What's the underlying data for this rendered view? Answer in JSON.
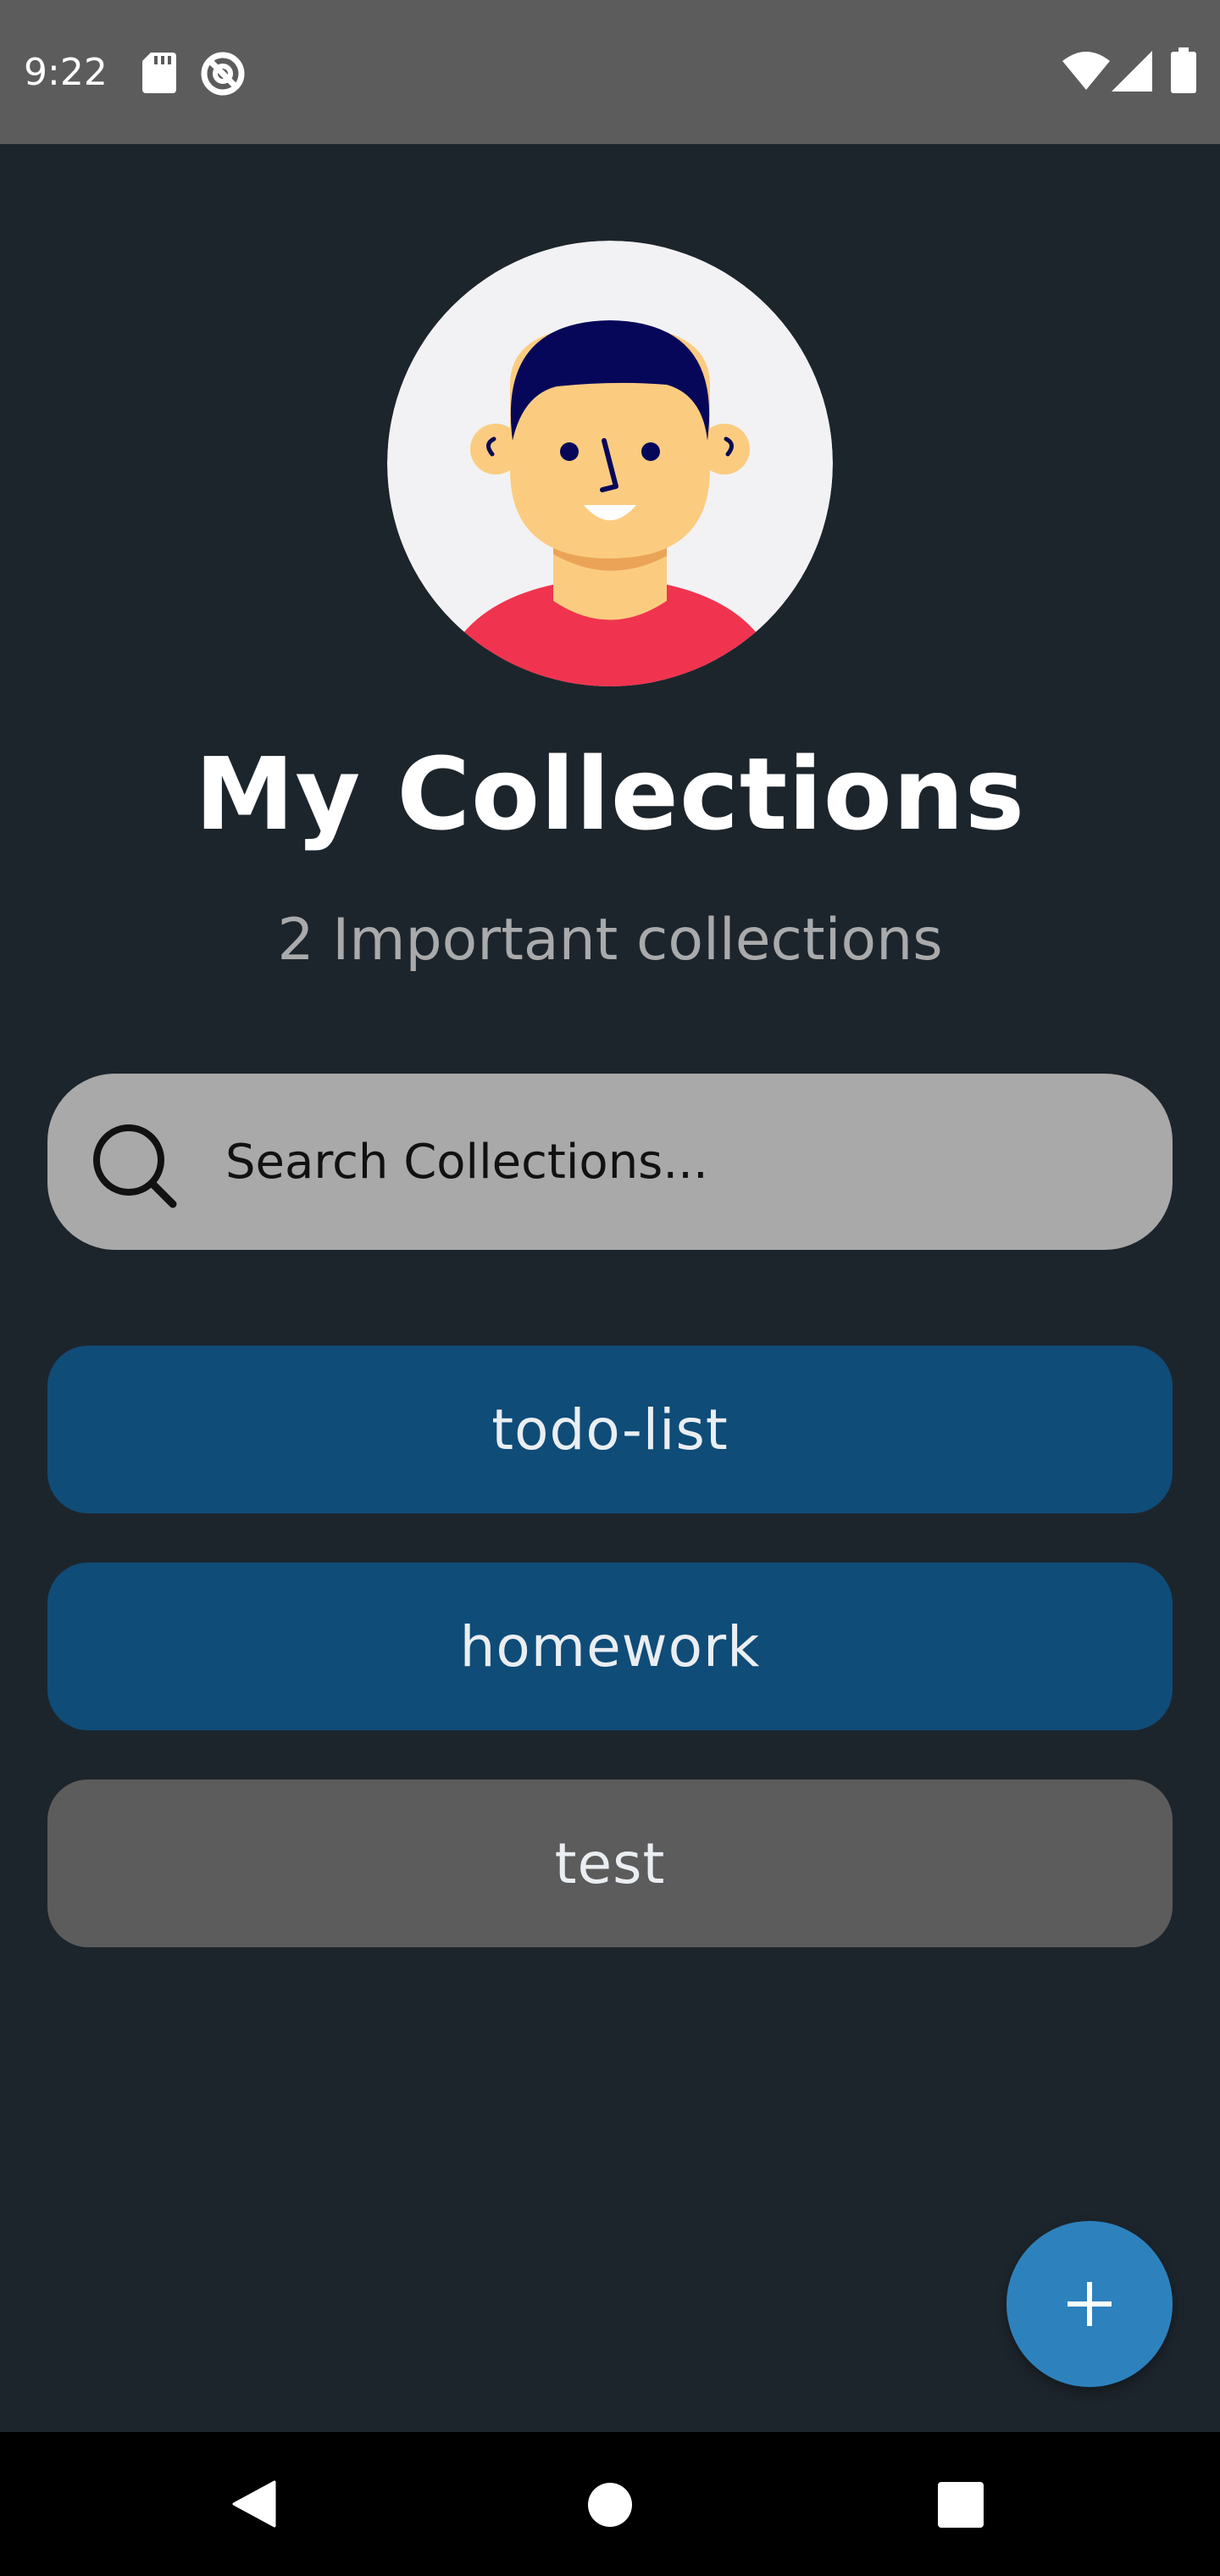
{
  "status_bar": {
    "time": "9:22",
    "left_icons": [
      "sd-card-icon",
      "do-not-disturb-icon"
    ],
    "right_icons": [
      "wifi-icon",
      "cell-signal-icon",
      "battery-icon"
    ]
  },
  "profile": {
    "avatar_icon": "avatar-illustration"
  },
  "header": {
    "title": "My Collections",
    "subtitle": "2 Important collections"
  },
  "search": {
    "placeholder": "Search Collections...",
    "value": "",
    "icon": "search-icon"
  },
  "collections": [
    {
      "label": "todo-list",
      "color": "#0f4c78"
    },
    {
      "label": "homework",
      "color": "#0f4c78"
    },
    {
      "label": "test",
      "color": "#5c5c5c"
    }
  ],
  "fab": {
    "icon": "plus-icon",
    "color": "#2d82bd"
  },
  "nav_bar": {
    "buttons": [
      "back-icon",
      "home-icon",
      "recents-icon"
    ]
  },
  "colors": {
    "background": "#1d252c",
    "status_bar": "#5c5c5c",
    "search_bar": "#a9a9a9",
    "subtitle": "#a9aaab"
  }
}
